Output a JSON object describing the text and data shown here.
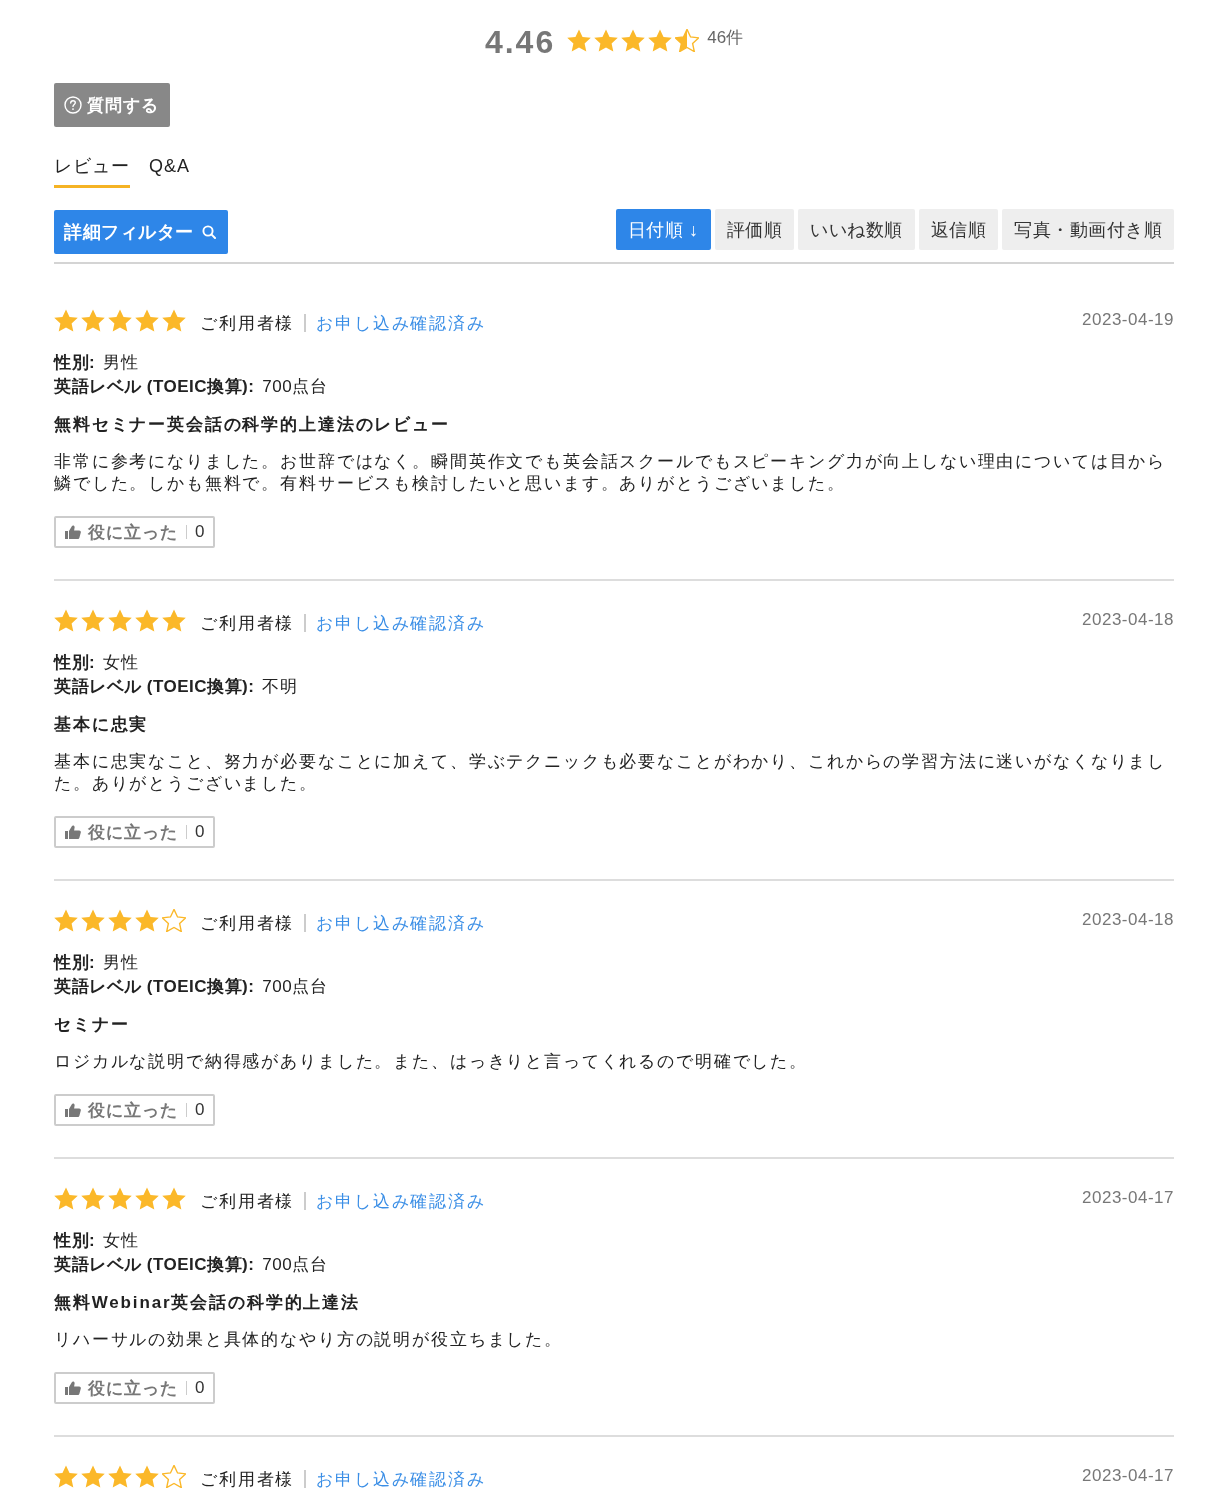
{
  "rating_summary": {
    "score": "4.46",
    "stars": 4.5,
    "count": "46件"
  },
  "ask_button": {
    "label": "質問する"
  },
  "tabs": [
    {
      "label": "レビュー",
      "selected": true
    },
    {
      "label": "Q&A",
      "selected": false
    }
  ],
  "filter_button": {
    "label": "詳細フィルター"
  },
  "sort_buttons": [
    {
      "label": "日付順 ↓",
      "selected": true
    },
    {
      "label": "評価順",
      "selected": false
    },
    {
      "label": "いいね数順",
      "selected": false
    },
    {
      "label": "返信順",
      "selected": false
    },
    {
      "label": "写真・動画付き順",
      "selected": false
    }
  ],
  "reviews": [
    {
      "stars": 5,
      "reviewer": "ご利用者様",
      "verified": "お申し込み確認済み",
      "date": "2023-04-19",
      "attributes": [
        {
          "label": "性別:",
          "value": "男性"
        },
        {
          "label": "英語レベル (TOEIC換算):",
          "value": "700点台"
        }
      ],
      "title": "無料セミナー英会話の科学的上達法のレビュー",
      "body": "非常に参考になりました。お世辞ではなく。瞬間英作文でも英会話スクールでもスピーキング力が向上しない理由については目から鱗でした。しかも無料で。有料サービスも検討したいと思います。ありがとうございました。",
      "helpful": {
        "label": "役に立った",
        "count": "0"
      }
    },
    {
      "stars": 5,
      "reviewer": "ご利用者様",
      "verified": "お申し込み確認済み",
      "date": "2023-04-18",
      "attributes": [
        {
          "label": "性別:",
          "value": "女性"
        },
        {
          "label": "英語レベル (TOEIC換算):",
          "value": "不明"
        }
      ],
      "title": "基本に忠実",
      "body": "基本に忠実なこと、努力が必要なことに加えて、学ぶテクニックも必要なことがわかり、これからの学習方法に迷いがなくなりました。ありがとうございました。",
      "helpful": {
        "label": "役に立った",
        "count": "0"
      }
    },
    {
      "stars": 4,
      "reviewer": "ご利用者様",
      "verified": "お申し込み確認済み",
      "date": "2023-04-18",
      "attributes": [
        {
          "label": "性別:",
          "value": "男性"
        },
        {
          "label": "英語レベル (TOEIC換算):",
          "value": "700点台"
        }
      ],
      "title": "セミナー",
      "body": "ロジカルな説明で納得感がありました。また、はっきりと言ってくれるので明確でした。",
      "helpful": {
        "label": "役に立った",
        "count": "0"
      }
    },
    {
      "stars": 5,
      "reviewer": "ご利用者様",
      "verified": "お申し込み確認済み",
      "date": "2023-04-17",
      "attributes": [
        {
          "label": "性別:",
          "value": "女性"
        },
        {
          "label": "英語レベル (TOEIC換算):",
          "value": "700点台"
        }
      ],
      "title": "無料Webinar英会話の科学的上達法",
      "body": "リハーサルの効果と具体的なやり方の説明が役立ちました。",
      "helpful": {
        "label": "役に立った",
        "count": "0"
      }
    },
    {
      "stars": 4,
      "reviewer": "ご利用者様",
      "verified": "お申し込み確認済み",
      "date": "2023-04-17"
    }
  ]
}
